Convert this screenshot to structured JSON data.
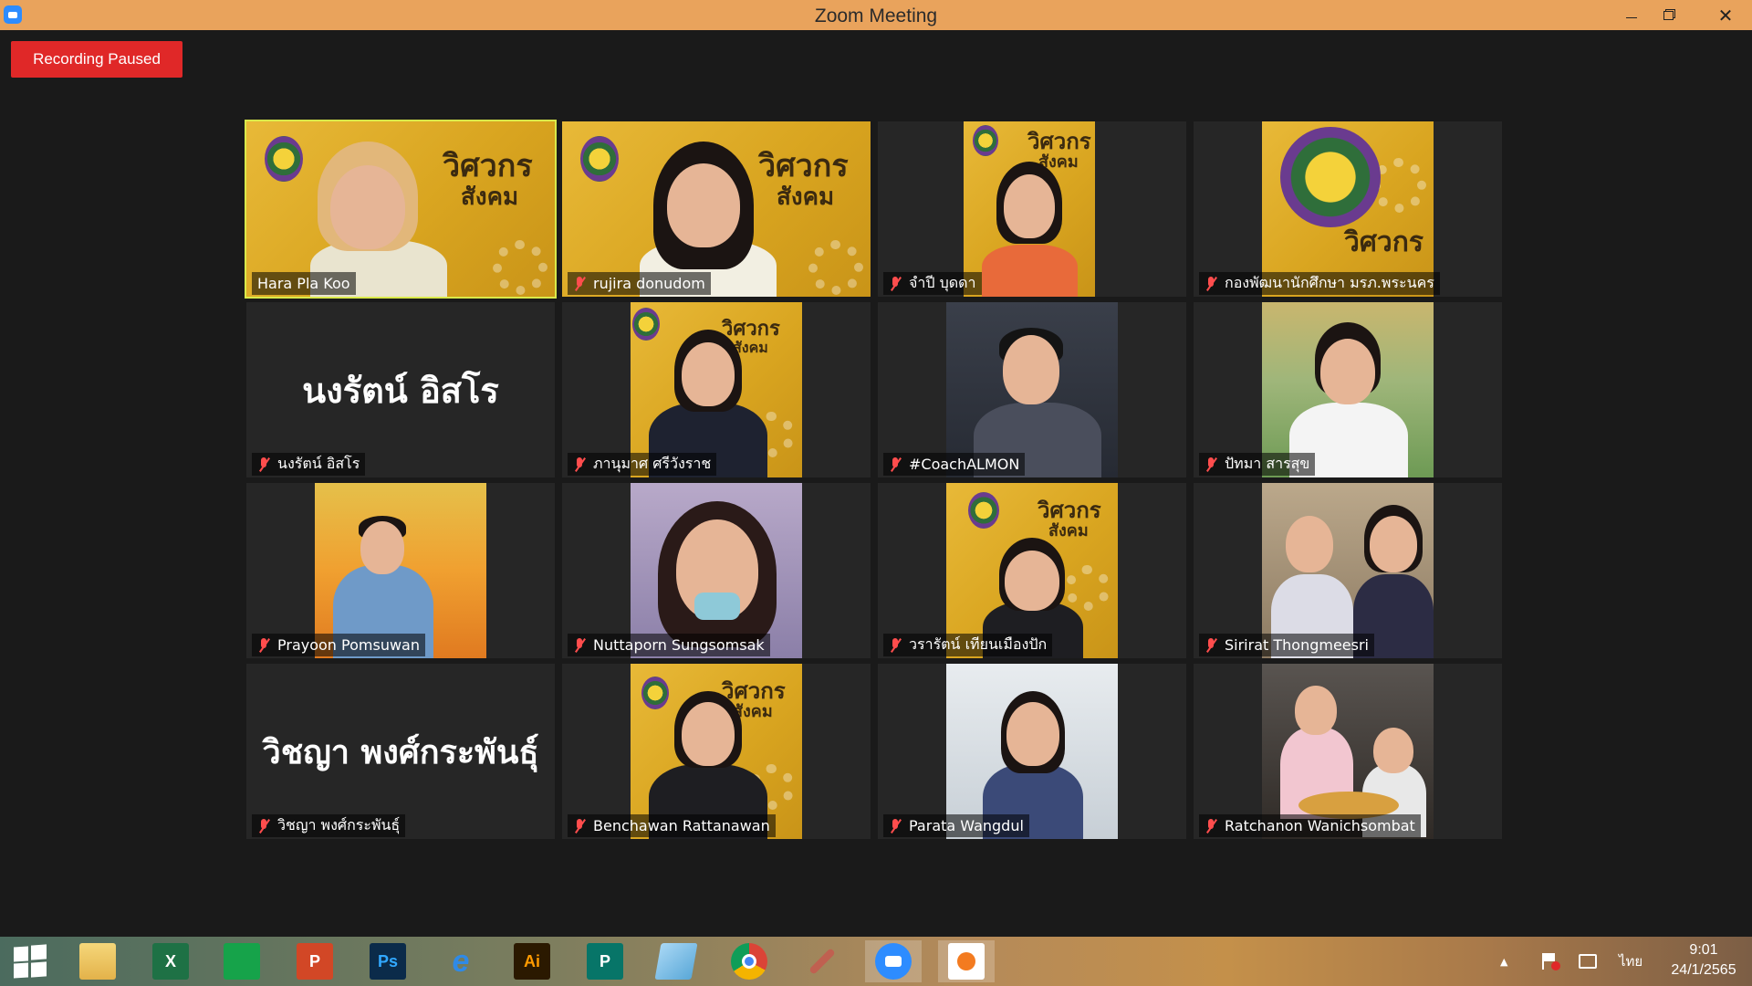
{
  "window": {
    "title": "Zoom Meeting",
    "minimize_glyph": "",
    "maximize_glyph": "",
    "close_glyph": "✕"
  },
  "meeting": {
    "recording_status": "Recording Paused"
  },
  "participants": [
    {
      "name": "Hara Pla Koo",
      "muted": false,
      "speaking": true
    },
    {
      "name": "rujira donudom",
      "muted": true
    },
    {
      "name": "จำปี บุดดา",
      "muted": true
    },
    {
      "name": "กองพัฒนานักศึกษา มรภ.พระนคร",
      "muted": true
    },
    {
      "name": "นงรัตน์ อิสโร",
      "muted": true,
      "display_name_large": "นงรัตน์ อิสโร"
    },
    {
      "name": "ภานุมาศ ศรีวังราช",
      "muted": true
    },
    {
      "name": "#CoachALMON",
      "muted": true
    },
    {
      "name": "ปัทมา สารสุข",
      "muted": true
    },
    {
      "name": "Prayoon Pomsuwan",
      "muted": true
    },
    {
      "name": "Nuttaporn Sungsomsak",
      "muted": true
    },
    {
      "name": "วรารัตน์ เทียนเมืองปัก",
      "muted": true
    },
    {
      "name": "Sirirat Thongmeesri",
      "muted": true
    },
    {
      "name": "วิชญา พงศ์กระพันธุ์",
      "muted": true,
      "display_name_large": "วิชญา พงศ์กระพันธุ์"
    },
    {
      "name": "Benchawan Rattanawan",
      "muted": true
    },
    {
      "name": "Parata Wangdul",
      "muted": true
    },
    {
      "name": "Ratchanon Wanichsombat",
      "muted": true
    }
  ],
  "banner": {
    "text_line1": "วิศวกร",
    "text_line2": "สังคม"
  },
  "taskbar": {
    "apps": [
      {
        "name": "start",
        "label": ""
      },
      {
        "name": "file-explorer",
        "label": ""
      },
      {
        "name": "excel",
        "label": "X"
      },
      {
        "name": "store",
        "label": ""
      },
      {
        "name": "powerpoint",
        "label": "P"
      },
      {
        "name": "photoshop",
        "label": "Ps"
      },
      {
        "name": "internet-explorer",
        "label": "e"
      },
      {
        "name": "illustrator",
        "label": "Ai"
      },
      {
        "name": "publisher",
        "label": "P"
      },
      {
        "name": "notepad",
        "label": ""
      },
      {
        "name": "chrome",
        "label": ""
      },
      {
        "name": "paint",
        "label": ""
      },
      {
        "name": "zoom",
        "label": ""
      },
      {
        "name": "photos",
        "label": ""
      }
    ],
    "active_app": "zoom",
    "language": "ไทย",
    "time": "9:01",
    "date": "24/1/2565",
    "tray_arrow": "▲"
  },
  "colors": {
    "titlebar": "#e9a35c",
    "recording_badge": "#e02828",
    "active_speaker_border": "#d9e94a",
    "muted_mic": "#ff4d4d",
    "zoom_blue": "#2d8cff",
    "tile_background": "#262626"
  }
}
